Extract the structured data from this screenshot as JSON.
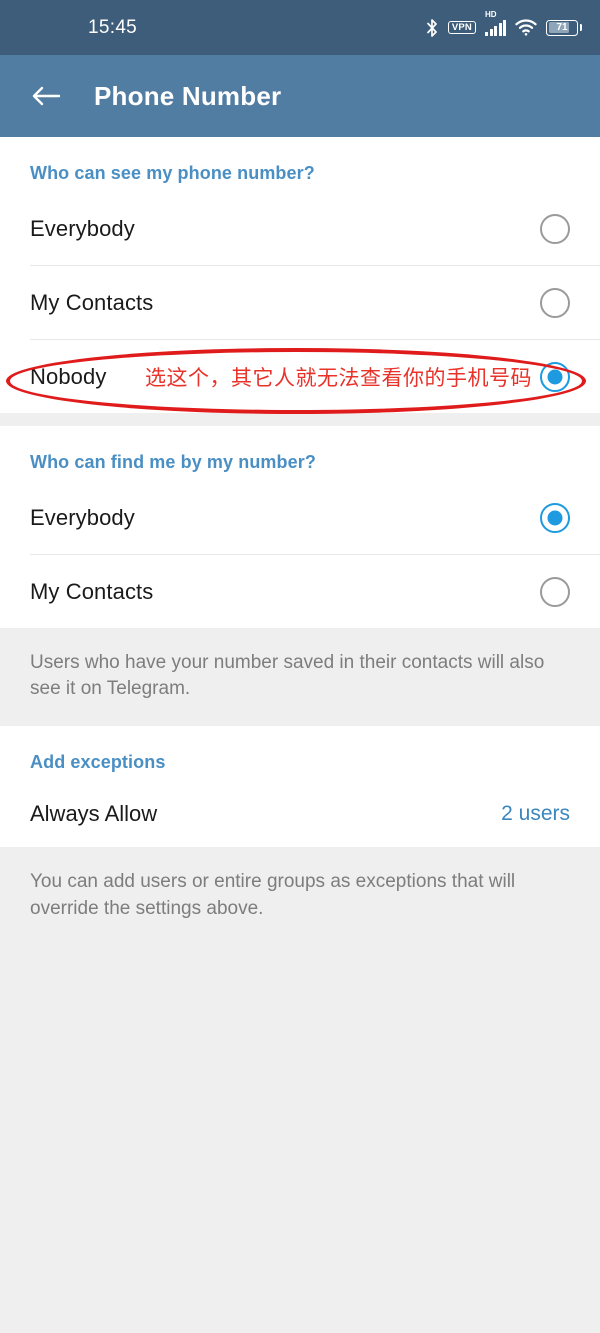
{
  "status_bar": {
    "time": "15:45",
    "icons": [
      "bluetooth-icon",
      "vpn-icon",
      "hd-signal-icon",
      "wifi-icon",
      "battery-icon"
    ],
    "vpn_label": "VPN",
    "hd_label": "HD",
    "battery_level": "71",
    "background_color": "#3d5d7a"
  },
  "app_bar": {
    "back_icon": "arrow-left-icon",
    "title": "Phone Number",
    "background_color": "#527da3"
  },
  "sections": [
    {
      "header": "Who can see my phone number?",
      "options": [
        {
          "label": "Everybody",
          "selected": false
        },
        {
          "label": "My Contacts",
          "selected": false
        },
        {
          "label": "Nobody",
          "selected": true
        }
      ]
    },
    {
      "header": "Who can find me by my number?",
      "options": [
        {
          "label": "Everybody",
          "selected": true
        },
        {
          "label": "My Contacts",
          "selected": false
        }
      ],
      "footnote": "Users who have your number saved in their contacts will also see it on Telegram."
    },
    {
      "header": "Add exceptions",
      "exception_row": {
        "label": "Always Allow",
        "value": "2 users"
      },
      "footnote": "You can add users or entire groups as exceptions that will override the settings above."
    }
  ],
  "annotation": {
    "text": "选这个，其它人就无法查看你的手机号码",
    "color": "#e8322a",
    "shape": "ellipse-highlight"
  },
  "colors": {
    "accent_blue": "#1e9ae0",
    "section_header_blue": "#4a8fc4",
    "link_blue": "#3a86bd",
    "page_background": "#efefef",
    "card_background": "#ffffff",
    "annotation_red": "#e01b1b"
  }
}
